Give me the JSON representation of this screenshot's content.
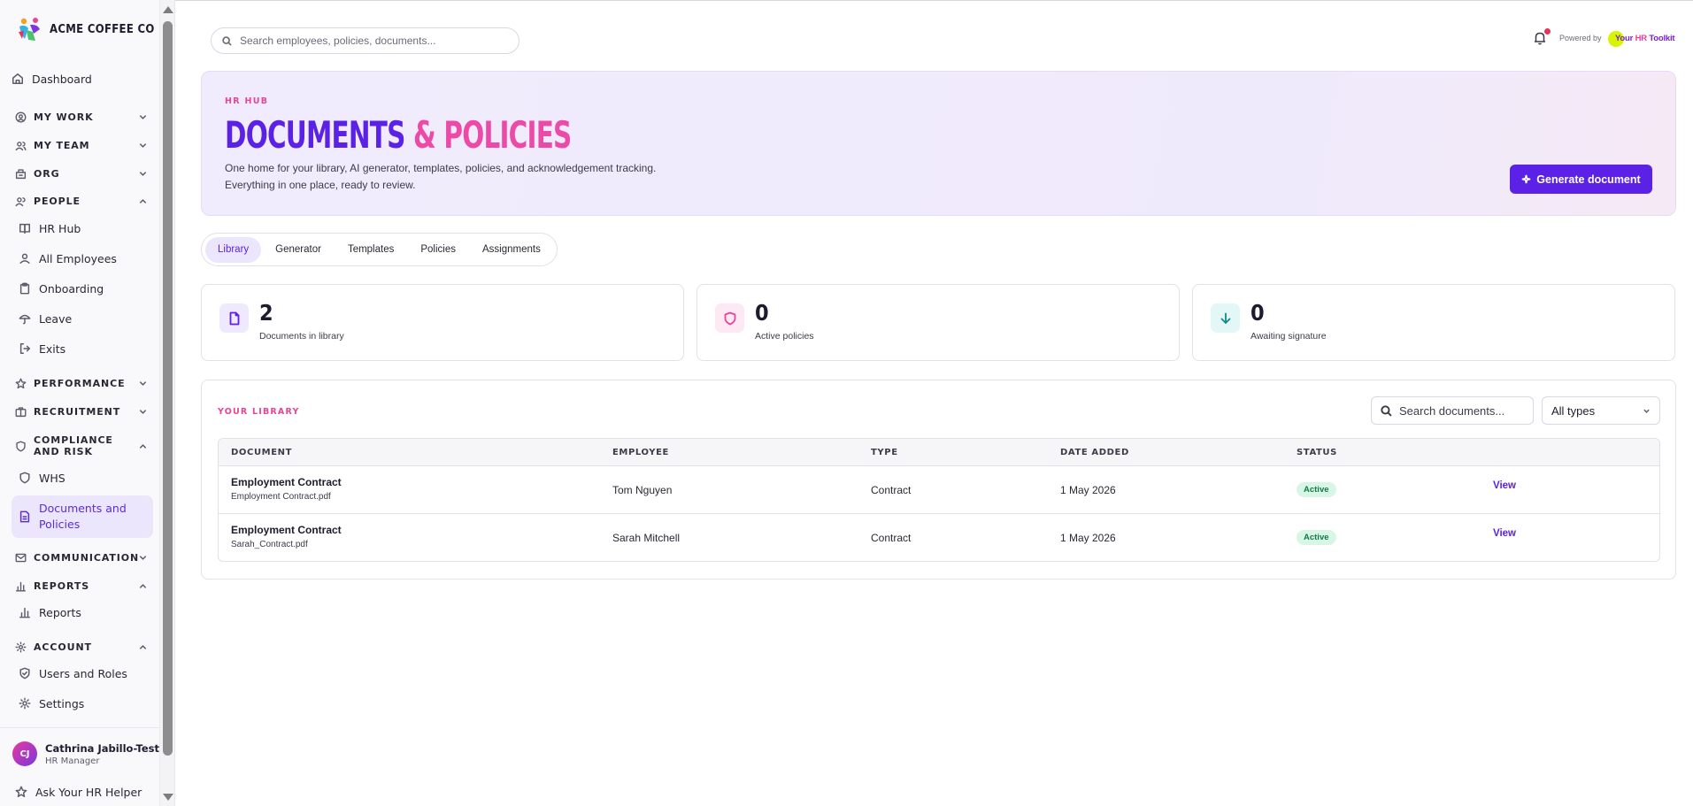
{
  "brand": {
    "name": "ACME COFFEE CO"
  },
  "sidebar": {
    "dashboard": "Dashboard",
    "sections": [
      {
        "label": "MY WORK",
        "expanded": false
      },
      {
        "label": "MY TEAM",
        "expanded": false
      },
      {
        "label": "ORG",
        "expanded": false
      },
      {
        "label": "PEOPLE",
        "expanded": true
      },
      {
        "label": "PERFORMANCE",
        "expanded": false
      },
      {
        "label": "RECRUITMENT",
        "expanded": false
      },
      {
        "label": "COMPLIANCE AND RISK",
        "expanded": true
      },
      {
        "label": "COMMUNICATION",
        "expanded": false
      },
      {
        "label": "REPORTS",
        "expanded": true
      },
      {
        "label": "ACCOUNT",
        "expanded": true
      }
    ],
    "people_items": [
      "HR Hub",
      "All Employees",
      "Onboarding",
      "Leave",
      "Exits"
    ],
    "compliance_items": [
      "WHS",
      "Documents and Policies"
    ],
    "reports_items": [
      "Reports"
    ],
    "account_items": [
      "Users and Roles",
      "Settings"
    ],
    "active_item": "Documents and Policies",
    "user": {
      "initials": "CJ",
      "name": "Cathrina Jabillo-Test",
      "role": "HR Manager"
    },
    "helper": "Ask Your HR Helper"
  },
  "topbar": {
    "search_placeholder": "Search employees, policies, documents...",
    "powered_by": "Powered by",
    "toolkit_a": "Your ",
    "toolkit_b": "HR",
    "toolkit_c": " Toolkit"
  },
  "hero": {
    "kicker": "HR HUB",
    "title_part1": "DOCUMENTS ",
    "title_part2": "& POLICIES",
    "desc_line1": "One home for your library, AI generator, templates, policies, and acknowledgement tracking.",
    "desc_line2": "Everything in one place, ready to review.",
    "button": "Generate document"
  },
  "tabs": [
    "Library",
    "Generator",
    "Templates",
    "Policies",
    "Assignments"
  ],
  "active_tab": "Library",
  "stats": [
    {
      "value": "2",
      "label": "Documents in library",
      "icon": "file-icon",
      "color": "#5b21e6",
      "bg": "#efe9fd"
    },
    {
      "value": "0",
      "label": "Active policies",
      "icon": "shield-icon",
      "color": "#e8449a",
      "bg": "#fde9f3"
    },
    {
      "value": "0",
      "label": "Awaiting signature",
      "icon": "arrow-down-icon",
      "color": "#0f8a8a",
      "bg": "#e3f7f7"
    }
  ],
  "library": {
    "title": "YOUR LIBRARY",
    "search_placeholder": "Search documents...",
    "filter": "All types",
    "columns": [
      "DOCUMENT",
      "EMPLOYEE",
      "TYPE",
      "DATE ADDED",
      "STATUS"
    ],
    "rows": [
      {
        "title": "Employment Contract",
        "file": "Employment Contract.pdf",
        "employee": "Tom Nguyen",
        "type": "Contract",
        "date": "1 May 2026",
        "status": "Active",
        "action": "View"
      },
      {
        "title": "Employment Contract",
        "file": "Sarah_Contract.pdf",
        "employee": "Sarah Mitchell",
        "type": "Contract",
        "date": "1 May 2026",
        "status": "Active",
        "action": "View"
      }
    ]
  }
}
